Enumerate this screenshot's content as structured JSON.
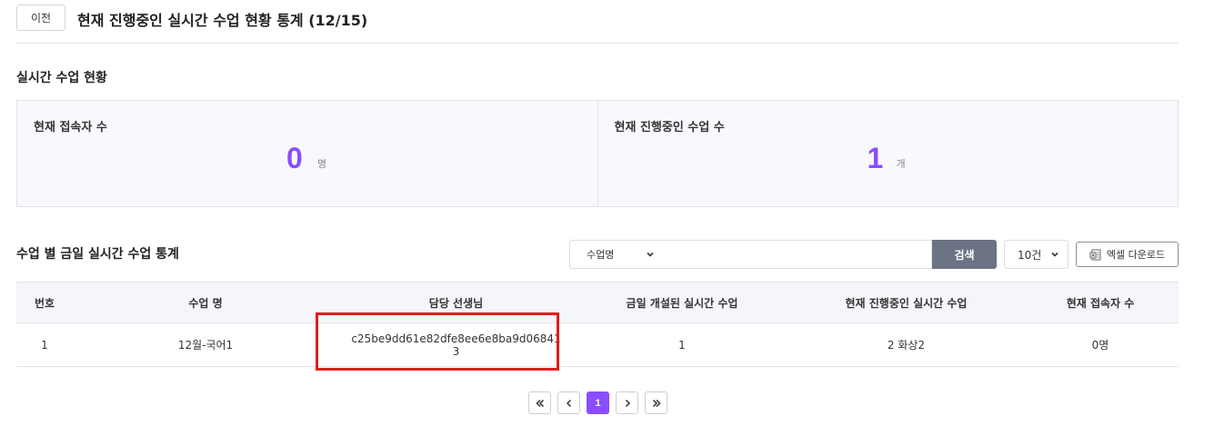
{
  "header": {
    "prev_label": "이전",
    "title": "현재 진행중인 실시간 수업 현황 통계 (12/15)"
  },
  "realtime": {
    "section_title": "실시간 수업 현황",
    "connected": {
      "label": "현재 접속자 수",
      "value": "0",
      "unit": "명"
    },
    "running": {
      "label": "현재 진행중인 수업 수",
      "value": "1",
      "unit": "개"
    }
  },
  "stats_table": {
    "section_title": "수업 별 금일 실시간 수업 통계",
    "search": {
      "field_selected": "수업명",
      "query": "",
      "button_label": "검색"
    },
    "page_size_selected": "10건",
    "excel_label": "엑셀 다운로드",
    "columns": [
      "번호",
      "수업 명",
      "담당 선생님",
      "금일 개설된 실시간 수업",
      "현재 진행중인 실시간 수업",
      "현재 접속자 수"
    ],
    "rows": [
      [
        "1",
        "12월-국어1",
        "c25be9dd61e82dfe8ee6e8ba9d068413",
        "1",
        "2 화상2",
        "0명"
      ]
    ]
  },
  "pagination": {
    "current_page": "1"
  },
  "colors": {
    "accent": "#8a4dff",
    "search_button": "#6b7384",
    "highlight_border": "#e11d1d"
  },
  "icons": [
    "chevron-down-icon",
    "excel-icon",
    "first-page-icon",
    "prev-page-icon",
    "next-page-icon",
    "last-page-icon"
  ]
}
